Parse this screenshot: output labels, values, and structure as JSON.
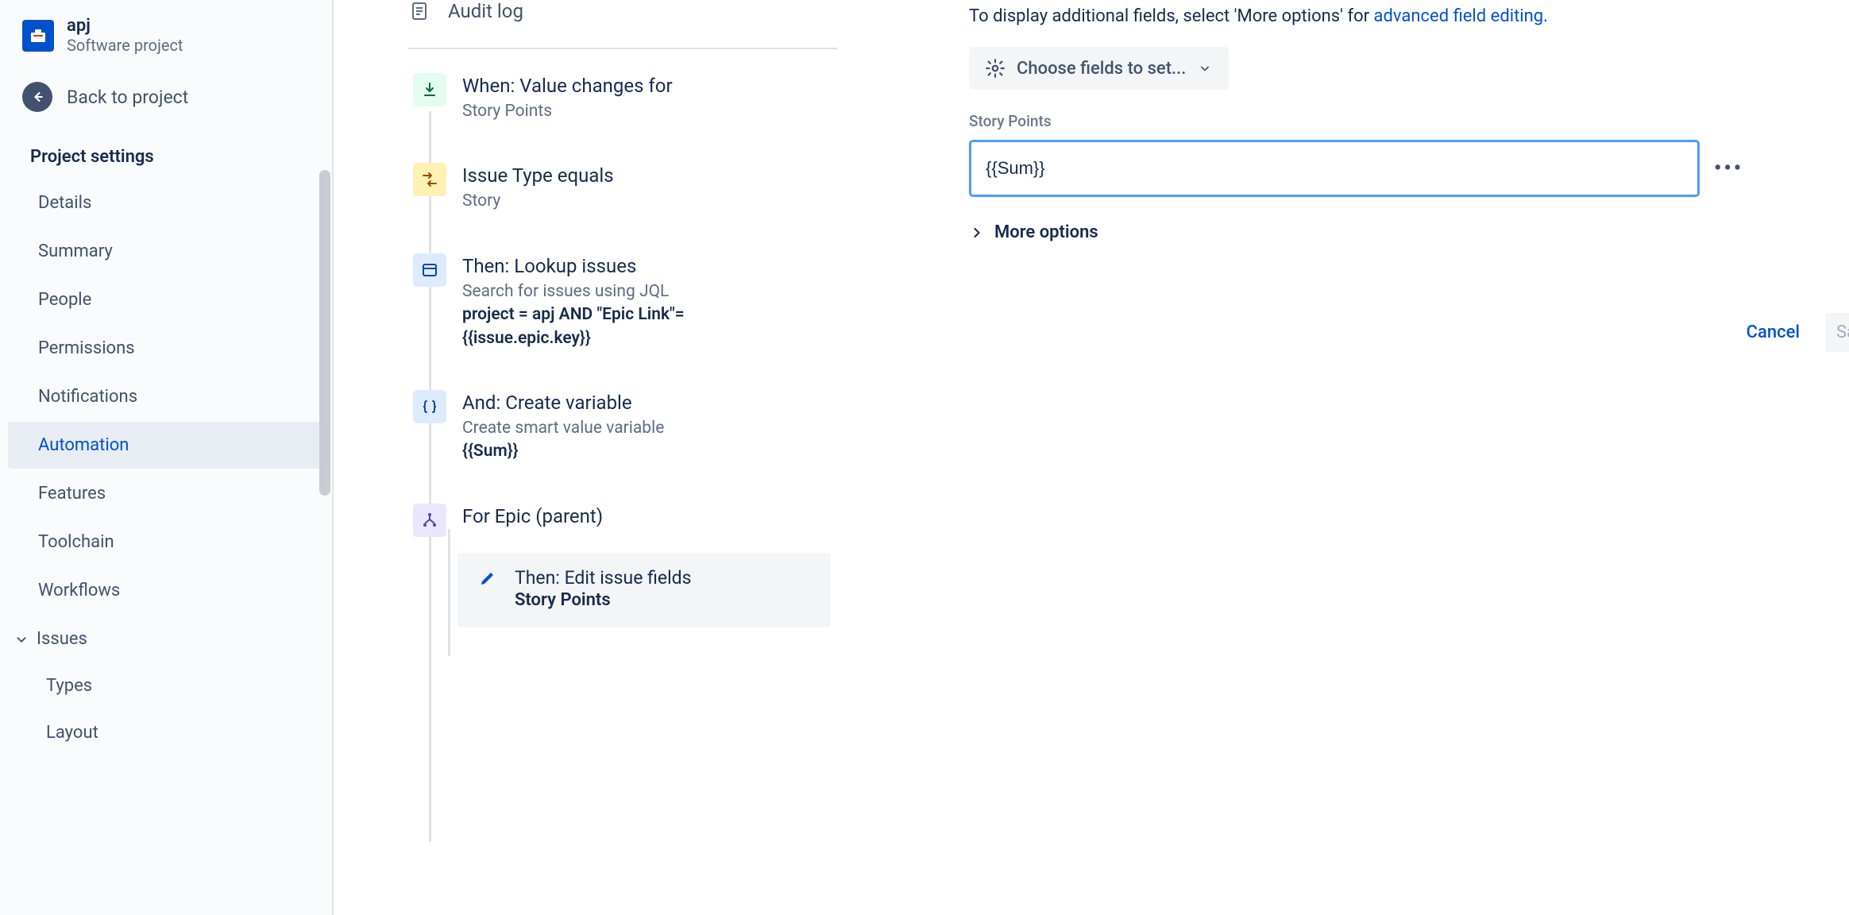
{
  "sidebar": {
    "project_name": "apj",
    "project_type": "Software project",
    "back_label": "Back to project",
    "settings_title": "Project settings",
    "items": [
      {
        "label": "Details"
      },
      {
        "label": "Summary"
      },
      {
        "label": "People"
      },
      {
        "label": "Permissions"
      },
      {
        "label": "Notifications"
      },
      {
        "label": "Automation"
      },
      {
        "label": "Features"
      },
      {
        "label": "Toolchain"
      },
      {
        "label": "Workflows"
      }
    ],
    "issues_label": "Issues",
    "issues_sub": [
      {
        "label": "Types"
      },
      {
        "label": "Layout"
      }
    ]
  },
  "rule": {
    "audit_log": "Audit log",
    "steps": {
      "trigger": {
        "title": "When: Value changes for",
        "sub": "Story Points"
      },
      "cond": {
        "title": "Issue Type equals",
        "sub": "Story"
      },
      "lookup": {
        "title": "Then: Lookup issues",
        "sub": "Search for issues using JQL",
        "jql": "project = apj AND \"Epic Link\"= {{issue.epic.key}}"
      },
      "createvar": {
        "title": "And: Create variable",
        "sub": "Create smart value variable",
        "var": "{{Sum}}"
      },
      "branch": {
        "title": "For Epic (parent)"
      },
      "then_edit": {
        "title": "Then: Edit issue fields",
        "field": "Story Points"
      }
    }
  },
  "panel": {
    "helper_pre": "To display additional fields, select 'More options' for ",
    "helper_link": "advanced field editing",
    "choose_fields": "Choose fields to set...",
    "field_label": "Story Points",
    "field_value": "{{Sum}}",
    "more_options": "More options",
    "cancel": "Cancel",
    "save": "Sav"
  }
}
